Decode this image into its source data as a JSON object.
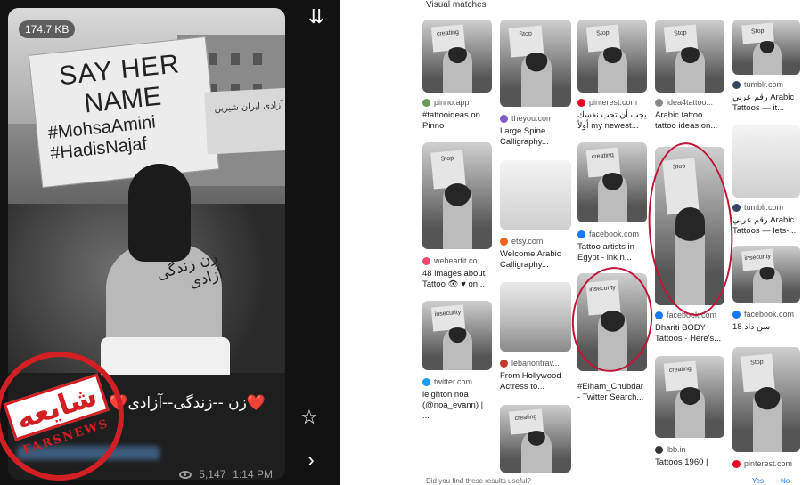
{
  "left": {
    "file_size": "174.7 KB",
    "sign_text": [
      "SAY HER",
      "NAME",
      "#MohsaAmini",
      "#HadisNajaf"
    ],
    "sign2_text": "آزادی ایران شیرین",
    "tattoo_text": "زن زندگی آزادی",
    "caption": "❤️زن --زندگی--آزادی❤️",
    "stamp_text": "شایعه",
    "stamp_brand": "FARSNEWS",
    "views": "5,147",
    "time": "1:14 PM",
    "icons": [
      "scroll-down-icon",
      "star-icon",
      "forward-icon"
    ]
  },
  "right": {
    "title": "Visual matches",
    "tiles": [
      {
        "source": "pinno.app",
        "title": "#tattooideas on Pinno",
        "color": "#6c9a5a"
      },
      {
        "source": "theyou.com",
        "title": "Large Spine Calligraphy...",
        "color": "#7b5cc7"
      },
      {
        "source": "pinterest.com",
        "title": "یجب أن تحب نفسك أولاً my newest...",
        "color": "#e60023"
      },
      {
        "source": "idea4tattoo...",
        "title": "Arabic tattoo tattoo ideas on...",
        "color": "#888888"
      },
      {
        "source": "tumblr.com",
        "title": "رقم عربي Arabic Tattoos — it...",
        "color": "#36465d"
      },
      {
        "source": "weheartit.co...",
        "title": "48 images about Tattoo 👁 ♥ on...",
        "color": "#e84b6b"
      },
      {
        "source": "etsy.com",
        "title": "Welcome Arabic Calligraphy...",
        "color": "#f1641e"
      },
      {
        "source": "facebook.com",
        "title": "Tattoo artists in Egypt - ink n...",
        "color": "#1877f2"
      },
      {
        "source": "facebook.com",
        "title": "Dhariti BODY Tattoos - Here's...",
        "color": "#1877f2"
      },
      {
        "source": "tumblr.com",
        "title": "رقم عربي Arabic Tattoos — lets-...",
        "color": "#36465d"
      },
      {
        "source": "facebook.com",
        "title": "سن داد 18",
        "color": "#1877f2"
      },
      {
        "source": "twitter.com",
        "title": "leighton noa (@noa_evann) | ...",
        "color": "#1d9bf0"
      },
      {
        "source": "lebanontrav...",
        "title": "From Hollywood Actress to...",
        "color": "#c0392b"
      },
      {
        "source": "",
        "title": "#Elham_Chubdar - Twitter Search...",
        "color": "#1d9bf0"
      },
      {
        "source": "lbb.in",
        "title": "Tattoos 1960 |",
        "color": "#333333"
      },
      {
        "source": "pinterest.com",
        "title": "",
        "color": "#e60023"
      }
    ],
    "sign_mini": [
      "Stop",
      "creating",
      "insecurity"
    ],
    "feedback": "Did you find these results useful?",
    "yes": "Yes",
    "no": "No"
  }
}
